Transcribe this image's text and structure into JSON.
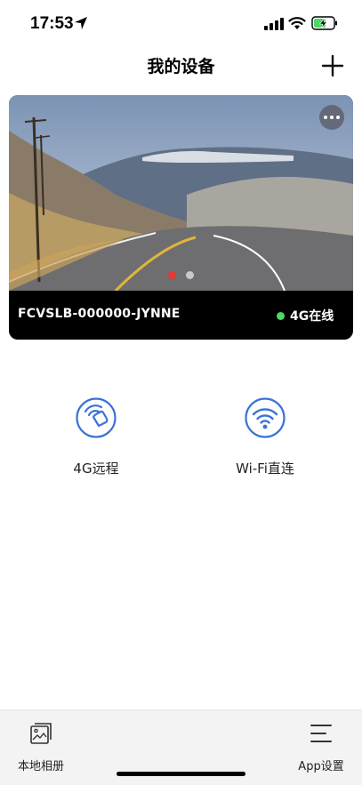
{
  "status_bar": {
    "time": "17:53"
  },
  "header": {
    "title": "我的设备"
  },
  "device": {
    "name": "FCVSLB-000000-JYNNE",
    "status": "4G在线",
    "status_color": "#4cd964",
    "pager": {
      "count": 2,
      "active_index": 0,
      "active_color": "#e53935",
      "inactive_color": "#c8c8c8"
    }
  },
  "connection_options": [
    {
      "label": "4G远程",
      "icon": "hand-signal-icon"
    },
    {
      "label": "Wi-Fi直连",
      "icon": "wifi-icon"
    }
  ],
  "accent_color": "#3a72d8",
  "tab_bar": {
    "items": [
      {
        "label": "本地相册",
        "icon": "photo-album-icon"
      },
      {
        "label": "App设置",
        "icon": "menu-icon"
      }
    ]
  }
}
